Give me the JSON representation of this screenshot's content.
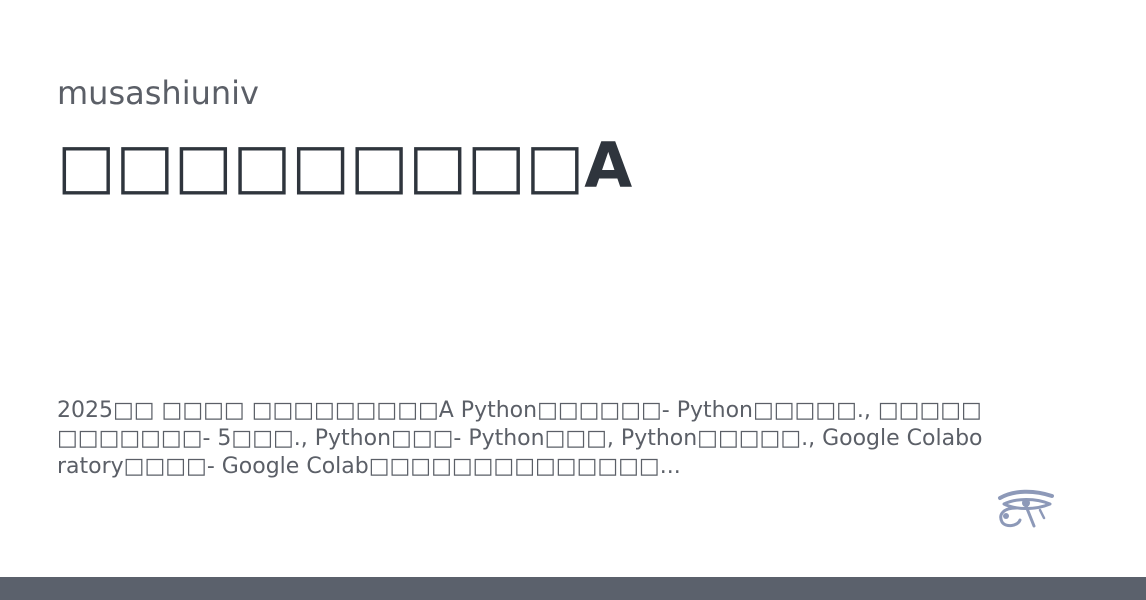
{
  "card": {
    "owner": "musashiuniv",
    "title": "□□□□□□□□□A",
    "description": "2025□□ □□□□ □□□□□□□□□A Python□□□□□□- Python□□□□□., □□□□□□□□□□□□- 5□□□., Python□□□- Python□□□, Python□□□□□., Google Colaboratory□□□□- Google Colab□□□□□□□□□□□□□□..."
  },
  "logo": {
    "icon": "eye-of-horus-icon",
    "color": "#8d99b8"
  },
  "footer": {
    "bar_color": "#5b616c"
  },
  "colors": {
    "title": "#2f353d",
    "text": "#5b5f67",
    "background": "#ffffff"
  }
}
